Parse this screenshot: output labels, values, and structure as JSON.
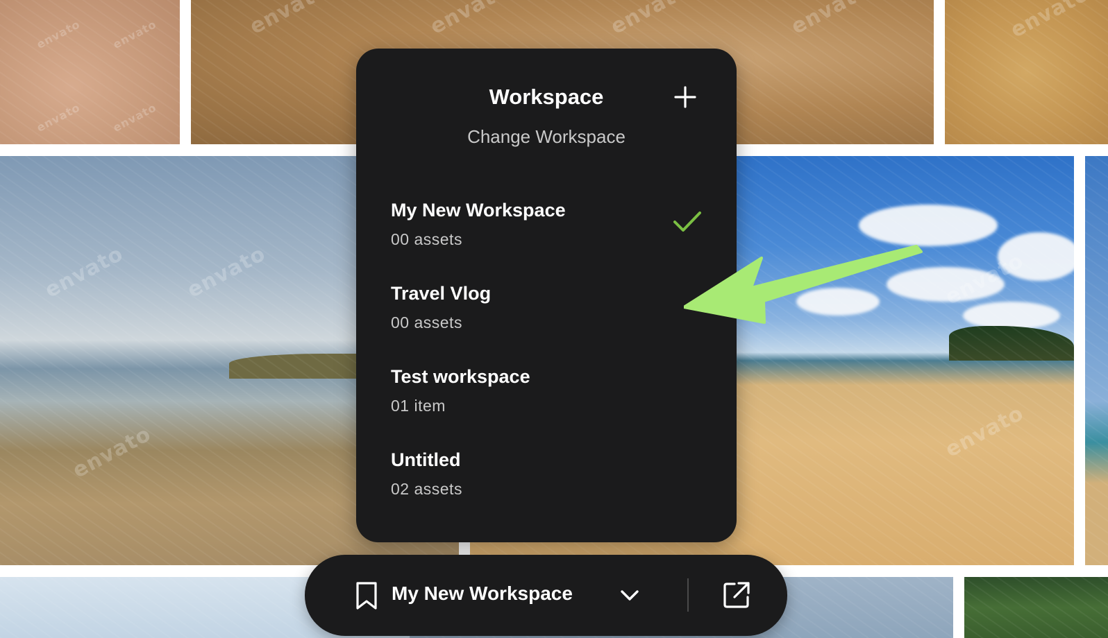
{
  "watermark": "envato",
  "workspace_panel": {
    "title": "Workspace",
    "subtitle": "Change Workspace",
    "add_icon": "plus-icon",
    "items": [
      {
        "name": "My New Workspace",
        "count": "00 assets",
        "selected": true
      },
      {
        "name": "Travel Vlog",
        "count": "00 assets",
        "selected": false
      },
      {
        "name": "Test workspace",
        "count": "01 item",
        "selected": false
      },
      {
        "name": "Untitled",
        "count": "02 assets",
        "selected": false
      }
    ],
    "check_color": "#7bc043"
  },
  "toolbar": {
    "current_workspace": "My New Workspace",
    "bookmark_icon": "bookmark-icon",
    "dropdown_icon": "chevron-down-icon",
    "open_icon": "external-link-icon"
  },
  "annotation": {
    "arrow_color": "#a8ea74",
    "arrow_icon": "arrow-left-icon"
  }
}
